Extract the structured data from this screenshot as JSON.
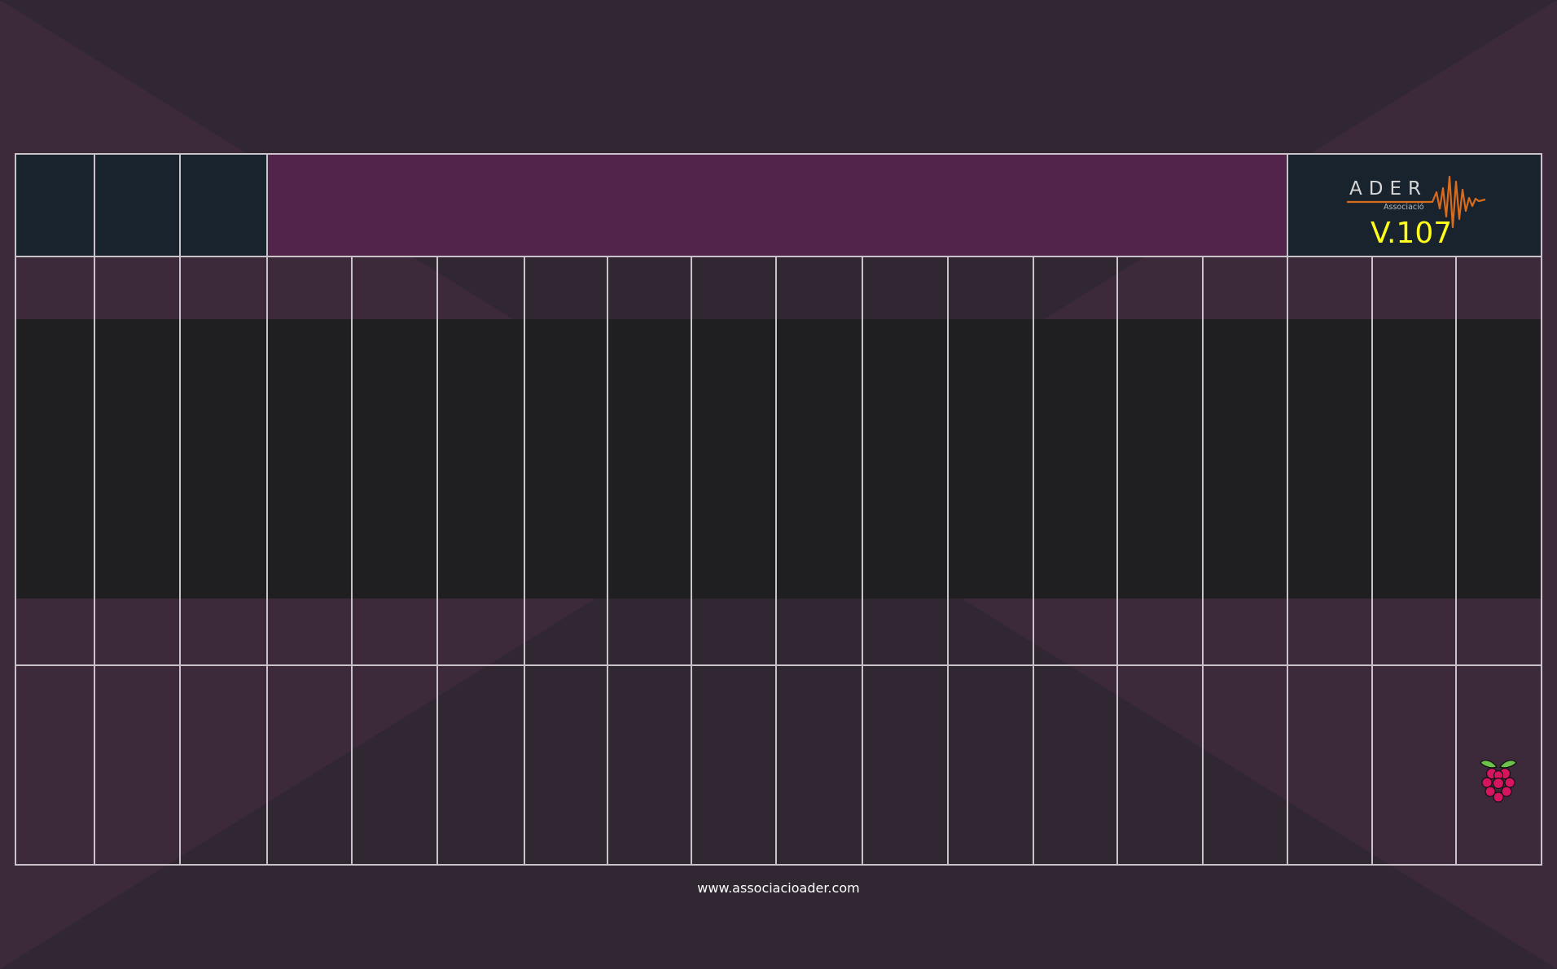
{
  "header": {
    "logo_text": "ADER",
    "logo_subtext": "Associació",
    "version": "V.107"
  },
  "panel": {
    "icon": "raspberry-pi-icon",
    "colors": {
      "header_cell": "#19232d",
      "header_title_band": "#53244b",
      "band": "#1f1e20",
      "grid_line": "#c9c2c9",
      "version_text": "#ffff1a",
      "logo_wave": "#d86c1c"
    }
  },
  "footer": {
    "url": "www.associacioader.com"
  }
}
